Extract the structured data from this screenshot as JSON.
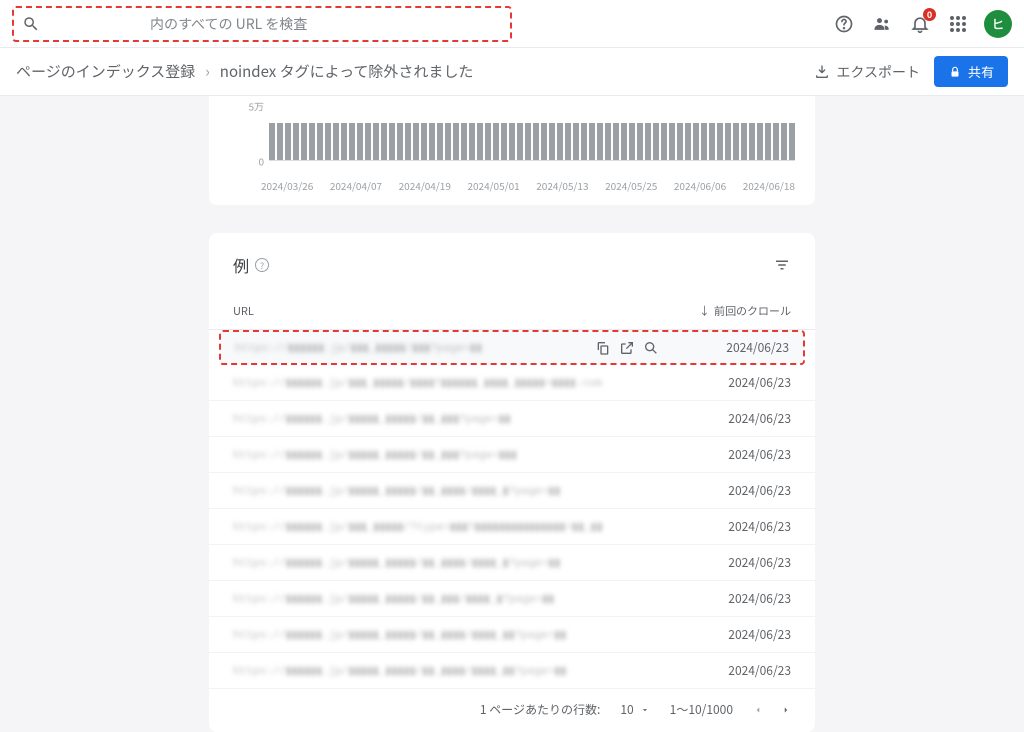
{
  "search": {
    "placeholder": "内のすべての URL を検査"
  },
  "header": {
    "notif_count": "0",
    "avatar_letter": "ヒ"
  },
  "breadcrumb": {
    "items": [
      "ページのインデックス登録",
      "noindex タグによって除外されました"
    ],
    "export": "エクスポート",
    "share": "共有"
  },
  "chart_data": {
    "type": "bar",
    "title": "",
    "xlabel": "",
    "ylabel": "",
    "ylim": [
      0,
      50000
    ],
    "y_ticks": [
      "5万",
      "0"
    ],
    "categories": [
      "2024/03/26",
      "2024/04/07",
      "2024/04/19",
      "2024/05/01",
      "2024/05/13",
      "2024/05/25",
      "2024/06/06",
      "2024/06/18"
    ],
    "values_approx": 34000,
    "bar_count": 66
  },
  "table": {
    "title": "例",
    "columns": {
      "url": "URL",
      "last_crawl": "前回のクロール"
    },
    "rows": [
      {
        "url": "https://▮▮▮▮▮▮.jp/▮▮▮_▮▮▮▮▮/▮▮▮?page=▮▮",
        "date": "2024/06/23",
        "highlighted": true
      },
      {
        "url": "https://▮▮▮▮▮▮.jp/▮▮▮_▮▮▮▮▮/▮▮▮▮?▮▮▮▮▮▮_▮▮▮▮_▮▮▮▮▮=▮▮▮▮.com",
        "date": "2024/06/23"
      },
      {
        "url": "https://▮▮▮▮▮▮.jp/▮▮▮▮▮_▮▮▮▮▮/▮▮_▮▮▮?page=▮▮",
        "date": "2024/06/23"
      },
      {
        "url": "https://▮▮▮▮▮▮.jp/▮▮▮▮▮_▮▮▮▮▮/▮▮_▮▮▮?page=▮▮▮",
        "date": "2024/06/23"
      },
      {
        "url": "https://▮▮▮▮▮▮.jp/▮▮▮▮▮_▮▮▮▮▮/▮▮_▮▮▮▮/▮▮▮▮_▮?page=▮▮",
        "date": "2024/06/23"
      },
      {
        "url": "https://▮▮▮▮▮▮.jp/▮▮▮_▮▮▮▮▮/?type=▮▮▮?▮▮▮▮▮▮▮▮▮▮▮▮▮▮▮=▮▮_▮▮",
        "date": "2024/06/23"
      },
      {
        "url": "https://▮▮▮▮▮▮.jp/▮▮▮▮▮_▮▮▮▮▮/▮▮_▮▮▮▮/▮▮▮▮_▮?page=▮▮",
        "date": "2024/06/23"
      },
      {
        "url": "https://▮▮▮▮▮▮.jp/▮▮▮▮▮_▮▮▮▮▮/▮▮_▮▮▮/▮▮▮▮_▮?page=▮▮",
        "date": "2024/06/23"
      },
      {
        "url": "https://▮▮▮▮▮▮.jp/▮▮▮▮▮_▮▮▮▮▮/▮▮_▮▮▮▮/▮▮▮▮_▮▮?page=▮▮",
        "date": "2024/06/23"
      },
      {
        "url": "https://▮▮▮▮▮▮.jp/▮▮▮▮▮_▮▮▮▮▮/▮▮_▮▮▮▮/▮▮▮▮_▮▮?page=▮▮",
        "date": "2024/06/23"
      }
    ],
    "pagination": {
      "rows_per_page_label": "1 ページあたりの行数:",
      "rows_per_page": "10",
      "range": "1～10/1000"
    }
  }
}
